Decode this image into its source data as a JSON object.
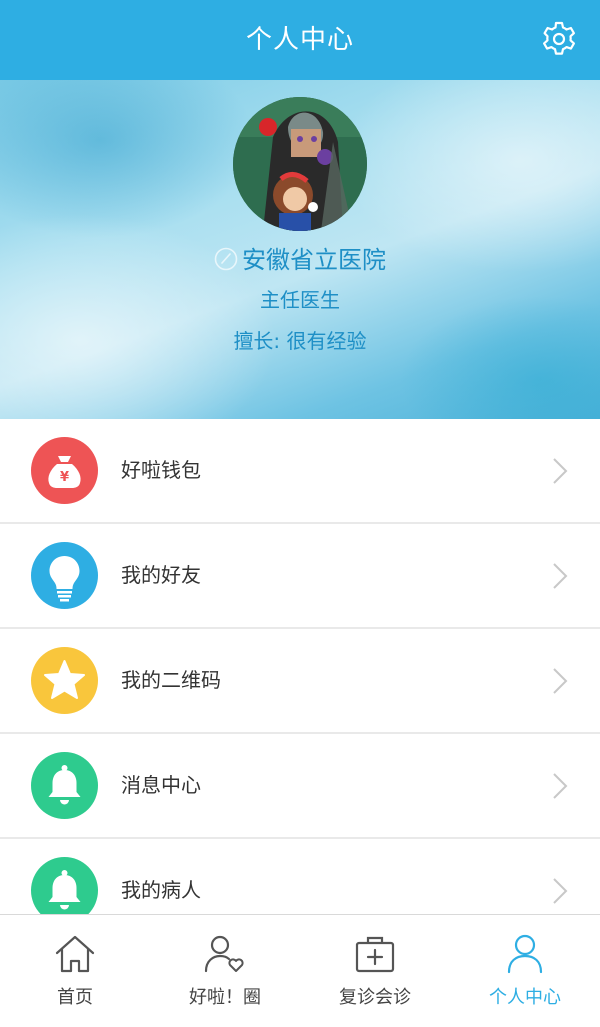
{
  "header": {
    "title": "个人中心",
    "settings_icon": "gear-icon",
    "color": "#2eaee3"
  },
  "profile": {
    "name": "安徽省立医院",
    "title": "主任医生",
    "specialty": "擅长: 很有经验",
    "edit_icon": "pencil-icon",
    "text_color": "#1e8fc6"
  },
  "menu": {
    "items": [
      {
        "label": "好啦钱包",
        "icon": "money-bag-icon",
        "color": "#ee5455"
      },
      {
        "label": "我的好友",
        "icon": "lightbulb-icon",
        "color": "#2eaee3"
      },
      {
        "label": "我的二维码",
        "icon": "star-icon",
        "color": "#f9c63c"
      },
      {
        "label": "消息中心",
        "icon": "bell-icon",
        "color": "#2ecb8e"
      },
      {
        "label": "我的病人",
        "icon": "bell-icon",
        "color": "#2ecb8e"
      }
    ]
  },
  "bottom_nav": {
    "items": [
      {
        "label": "首页",
        "icon": "home-icon"
      },
      {
        "label": "好啦！圈",
        "icon": "user-heart-icon"
      },
      {
        "label": "复诊会诊",
        "icon": "medical-kit-icon"
      },
      {
        "label": "个人中心",
        "icon": "user-icon",
        "active": true
      }
    ],
    "active_color": "#2eaee3"
  }
}
